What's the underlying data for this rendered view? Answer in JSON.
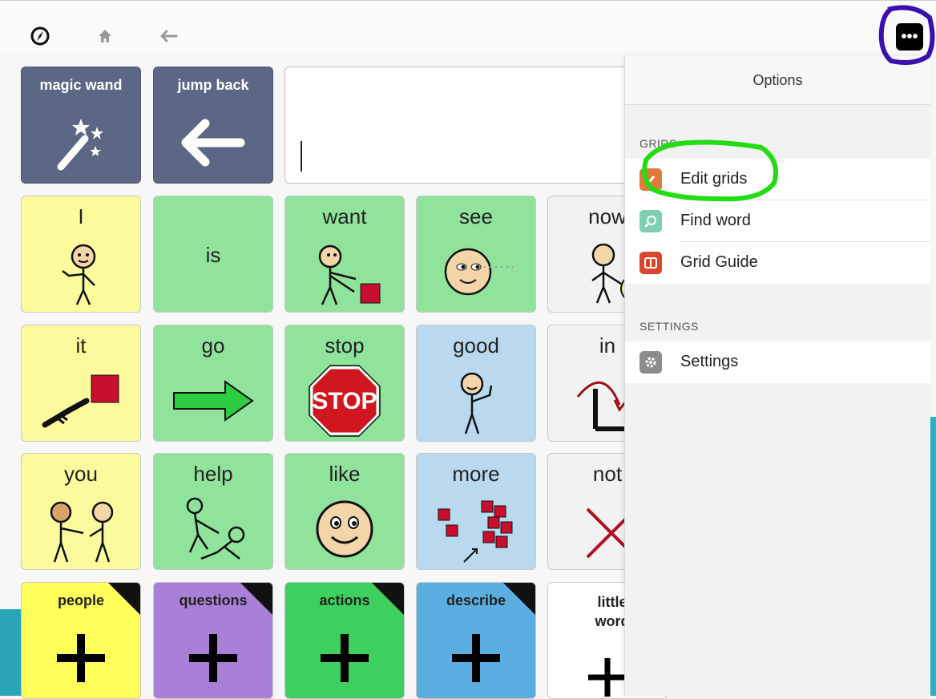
{
  "toolbar": {
    "compass_icon": "compass-icon",
    "home_icon": "home-icon",
    "back_icon": "back-arrow-icon",
    "more_icon": "more-icon"
  },
  "top_tiles": [
    {
      "label": "magic wand",
      "icon": "magic-wand-icon"
    },
    {
      "label": "jump back",
      "icon": "left-arrow-icon"
    }
  ],
  "grid": {
    "row1": [
      "I",
      "is",
      "want",
      "see",
      "now"
    ],
    "row2": [
      "it",
      "go",
      "stop",
      "good",
      "in"
    ],
    "row3": [
      "you",
      "help",
      "like",
      "more",
      "not"
    ],
    "folders": [
      "people",
      "questions",
      "actions",
      "describe",
      "little word"
    ]
  },
  "stop_sign_text": "STOP",
  "options_panel": {
    "title": "Options",
    "grids_section": "GRIDS",
    "grids_items": [
      "Edit grids",
      "Find word",
      "Grid Guide"
    ],
    "settings_section": "SETTINGS",
    "settings_items": [
      "Settings"
    ]
  },
  "colors": {
    "navy": "#5b6785",
    "yellow": "#fbfb9e",
    "green": "#8fe39a",
    "blue": "#b8d9ee",
    "folder_yellow": "#ffff5a",
    "folder_purple": "#a980d8",
    "folder_green": "#3ed05f",
    "folder_blue": "#5baee0",
    "annotation_green": "#22dd11",
    "annotation_purple": "#3b0fb0"
  }
}
